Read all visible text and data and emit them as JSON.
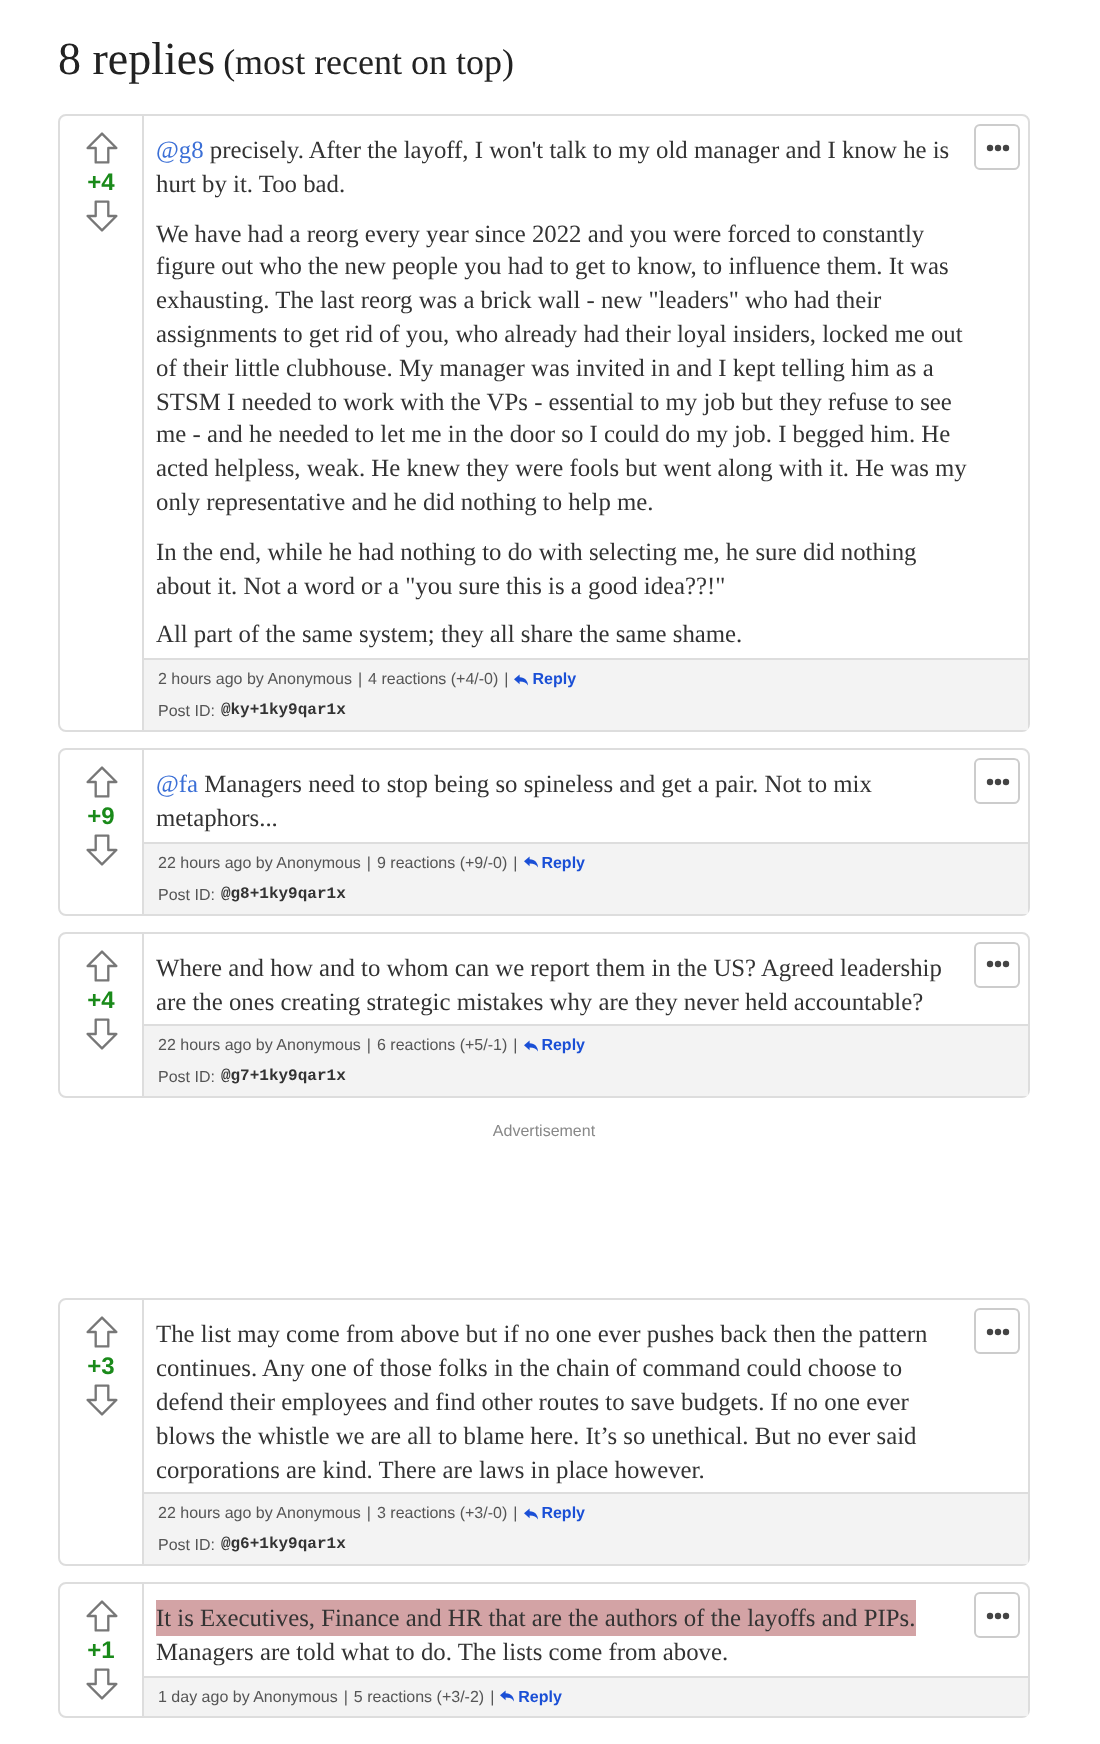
{
  "heading": {
    "title": "8 replies",
    "subtitle": "(most recent on top)"
  },
  "comments": [
    {
      "score": "+4",
      "paragraphs": [
        {
          "mention": "@g8",
          "segments": [
            {
              "text": " precisely. After the layoff, I won't talk to my old manager and I know he is hurt by it. Too bad.",
              "highlighted": false
            }
          ]
        },
        {
          "segments": [
            {
              "text": "We have had a reorg every year since 2022 and you were forced to constantly figure out who the new people you had to get to know, to influence them. It was exhausting. The last reorg was a brick wall - new \"leaders\" who had their assignments to get rid of you, who already had their loyal insiders, locked me out of their little clubhouse. My manager was invited in and I kept telling him as a STSM I needed to work with the VPs - essential to my job but they refuse to see me - and he needed to let me in the door so I could do my job. I begged him. He acted helpless, weak. He knew they were fools but went along with it. He was my only representative and he did nothing to help me.",
              "highlighted": false
            }
          ]
        },
        {
          "segments": [
            {
              "text": "In the end, while he had nothing to do with selecting me, he sure did nothing about it. Not a word or a \"you sure this is a good idea??!\"",
              "highlighted": false
            }
          ]
        },
        {
          "segments": [
            {
              "text": "All part of the same system; they all share the same shame.",
              "highlighted": false
            }
          ]
        }
      ],
      "meta": "2 hours ago by Anonymous",
      "separator": "|",
      "reactions": "4 reactions (+4/-0)",
      "reply": "Reply",
      "post_id_label": "Post ID:",
      "post_id": "@ky+1ky9qar1x"
    },
    {
      "score": "+9",
      "paragraphs": [
        {
          "mention": "@fa",
          "segments": [
            {
              "text": " Managers need to stop being so spineless and get a pair. Not to mix metaphors...",
              "highlighted": false
            }
          ]
        }
      ],
      "meta": "22 hours ago by Anonymous",
      "separator": "|",
      "reactions": "9 reactions (+9/-0)",
      "reply": "Reply",
      "post_id_label": "Post ID:",
      "post_id": "@g8+1ky9qar1x"
    },
    {
      "score": "+4",
      "paragraphs": [
        {
          "segments": [
            {
              "text": "Where and how and to whom can we report them in the US? Agreed leadership are the ones creating strategic mistakes why are they never held accountable?",
              "highlighted": false
            }
          ]
        }
      ],
      "meta": "22 hours ago by Anonymous",
      "separator": "|",
      "reactions": "6 reactions (+5/-1)",
      "reply": "Reply",
      "post_id_label": "Post ID:",
      "post_id": "@g7+1ky9qar1x"
    },
    {
      "kind": "advertisement",
      "label": "Advertisement"
    },
    {
      "score": "+3",
      "paragraphs": [
        {
          "segments": [
            {
              "text": "The list may come from above but if no one ever pushes back then the pattern continues. Any one of those folks in the chain of command could choose to defend their employees and find other routes to save budgets. If no one ever blows the whistle we are all to blame here. It’s so unethical. But no ever said corporations are kind. There are laws in place however.",
              "highlighted": false
            }
          ]
        }
      ],
      "meta": "22 hours ago by Anonymous",
      "separator": "|",
      "reactions": "3 reactions (+3/-0)",
      "reply": "Reply",
      "post_id_label": "Post ID:",
      "post_id": "@g6+1ky9qar1x"
    },
    {
      "score": "+1",
      "paragraphs": [
        {
          "segments": [
            {
              "text": "It is Executives, Finance and HR that are the authors of the layoffs and PIPs.",
              "highlighted": true
            },
            {
              "text": " Managers are told what to do. The lists come from above.",
              "highlighted": false
            }
          ]
        }
      ],
      "meta": "1 day ago by Anonymous",
      "separator": "|",
      "reactions": "5 reactions (+3/-2)",
      "reply": "Reply"
    }
  ]
}
